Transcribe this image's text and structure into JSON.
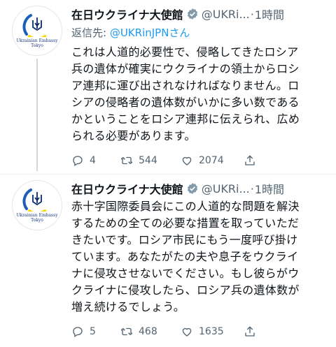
{
  "tweets": [
    {
      "author": "在日ウクライナ大使館",
      "handle": "@UKRi...",
      "dot": "·",
      "time": "1時間",
      "reply_prefix": "返信先: ",
      "reply_to": "@UKRinJPNさん",
      "body": "これは人道的必要性で、侵略してきたロシア\n兵の遺体が確実にウクライナの領土からロシ\nア連邦に運び出されなければなりません。ロ\nシアの侵略者の遺体数がいかに多い数である\nかということをロシア連邦に伝えられ、広め\nられる必要があります。",
      "replies": "4",
      "retweets": "544",
      "likes": "2074"
    },
    {
      "author": "在日ウクライナ大使館",
      "handle": "@UKRi...",
      "dot": "·",
      "time": "1時間",
      "body": "赤十字国際委員会にこの人道的な問題を解決\nするための全ての必要な措置を取っていただ\nきたいです。ロシア市民にもう一度呼び掛け\nています。あなたがたの夫や息子をウクライ\nナに侵攻させないでください。もし彼らがウ\nクライナに侵攻したら、ロシア兵の遺体数が\n増え続けるでしょう。",
      "replies": "5",
      "retweets": "468",
      "likes": "1635"
    }
  ],
  "avatar_caption": "Ukrainian Embassy\nTokyo",
  "colors": {
    "accent": "#1d9bf0",
    "muted": "#536471",
    "flag_blue": "#0057b7",
    "flag_yellow": "#ffd700"
  }
}
